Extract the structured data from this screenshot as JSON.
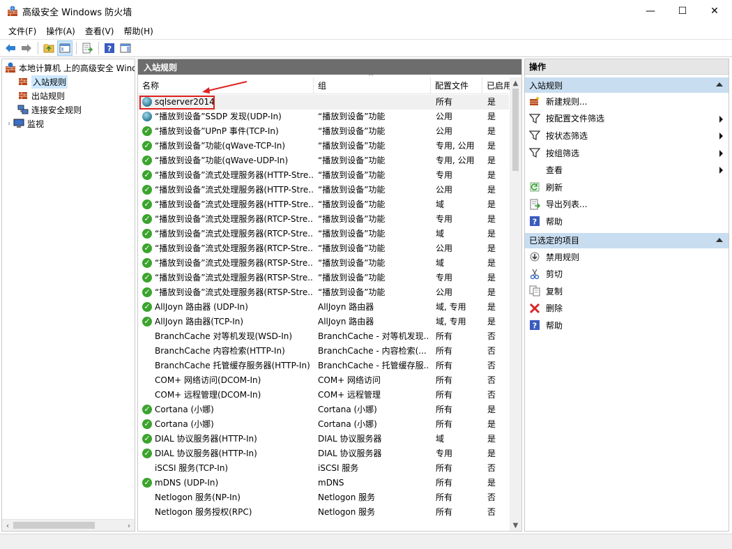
{
  "window": {
    "title": "高级安全 Windows 防火墙",
    "minimize": "—",
    "maximize": "☐",
    "close": "✕"
  },
  "menu": [
    "文件(F)",
    "操作(A)",
    "查看(V)",
    "帮助(H)"
  ],
  "toolbar": {
    "icons": [
      "back-arrow-icon",
      "forward-arrow-icon",
      "up-folder-icon",
      "show-hide-tree-icon",
      "export-list-icon",
      "help-icon",
      "show-hide-action-pane-icon"
    ]
  },
  "tree": {
    "root": "本地计算机 上的高级安全 Windows 防火墙",
    "items": [
      "入站规则",
      "出站规则",
      "连接安全规则",
      "监视"
    ]
  },
  "center": {
    "header": "入站规则",
    "columns": [
      "名称",
      "组",
      "配置文件",
      "已启用"
    ],
    "rows": [
      {
        "name": "sqlserver2014",
        "group": "",
        "profile": "所有",
        "enabled": "是",
        "icon": "globe"
      },
      {
        "name": "“播放到设备”SSDP 发现(UDP-In)",
        "group": "“播放到设备”功能",
        "profile": "公用",
        "enabled": "是",
        "icon": "globe"
      },
      {
        "name": "“播放到设备”UPnP 事件(TCP-In)",
        "group": "“播放到设备”功能",
        "profile": "公用",
        "enabled": "是",
        "icon": "check"
      },
      {
        "name": "“播放到设备”功能(qWave-TCP-In)",
        "group": "“播放到设备”功能",
        "profile": "专用, 公用",
        "enabled": "是",
        "icon": "check"
      },
      {
        "name": "“播放到设备”功能(qWave-UDP-In)",
        "group": "“播放到设备”功能",
        "profile": "专用, 公用",
        "enabled": "是",
        "icon": "check"
      },
      {
        "name": "“播放到设备”流式处理服务器(HTTP-Stre...",
        "group": "“播放到设备”功能",
        "profile": "专用",
        "enabled": "是",
        "icon": "check"
      },
      {
        "name": "“播放到设备”流式处理服务器(HTTP-Stre...",
        "group": "“播放到设备”功能",
        "profile": "公用",
        "enabled": "是",
        "icon": "check"
      },
      {
        "name": "“播放到设备”流式处理服务器(HTTP-Stre...",
        "group": "“播放到设备”功能",
        "profile": "域",
        "enabled": "是",
        "icon": "check"
      },
      {
        "name": "“播放到设备”流式处理服务器(RTCP-Stre...",
        "group": "“播放到设备”功能",
        "profile": "专用",
        "enabled": "是",
        "icon": "check"
      },
      {
        "name": "“播放到设备”流式处理服务器(RTCP-Stre...",
        "group": "“播放到设备”功能",
        "profile": "域",
        "enabled": "是",
        "icon": "check"
      },
      {
        "name": "“播放到设备”流式处理服务器(RTCP-Stre...",
        "group": "“播放到设备”功能",
        "profile": "公用",
        "enabled": "是",
        "icon": "check"
      },
      {
        "name": "“播放到设备”流式处理服务器(RTSP-Stre...",
        "group": "“播放到设备”功能",
        "profile": "域",
        "enabled": "是",
        "icon": "check"
      },
      {
        "name": "“播放到设备”流式处理服务器(RTSP-Stre...",
        "group": "“播放到设备”功能",
        "profile": "专用",
        "enabled": "是",
        "icon": "check"
      },
      {
        "name": "“播放到设备”流式处理服务器(RTSP-Stre...",
        "group": "“播放到设备”功能",
        "profile": "公用",
        "enabled": "是",
        "icon": "check"
      },
      {
        "name": "AllJoyn 路由器 (UDP-In)",
        "group": "AllJoyn 路由器",
        "profile": "域, 专用",
        "enabled": "是",
        "icon": "check"
      },
      {
        "name": "AllJoyn 路由器(TCP-In)",
        "group": "AllJoyn 路由器",
        "profile": "域, 专用",
        "enabled": "是",
        "icon": "check"
      },
      {
        "name": "BranchCache 对等机发现(WSD-In)",
        "group": "BranchCache - 对等机发现...",
        "profile": "所有",
        "enabled": "否",
        "icon": "none"
      },
      {
        "name": "BranchCache 内容检索(HTTP-In)",
        "group": "BranchCache - 内容检索(...",
        "profile": "所有",
        "enabled": "否",
        "icon": "none"
      },
      {
        "name": "BranchCache 托管缓存服务器(HTTP-In)",
        "group": "BranchCache - 托管缓存服...",
        "profile": "所有",
        "enabled": "否",
        "icon": "none"
      },
      {
        "name": "COM+ 网络访问(DCOM-In)",
        "group": "COM+ 网络访问",
        "profile": "所有",
        "enabled": "否",
        "icon": "none"
      },
      {
        "name": "COM+ 远程管理(DCOM-In)",
        "group": "COM+ 远程管理",
        "profile": "所有",
        "enabled": "否",
        "icon": "none"
      },
      {
        "name": "Cortana (小娜)",
        "group": "Cortana (小娜)",
        "profile": "所有",
        "enabled": "是",
        "icon": "check"
      },
      {
        "name": "Cortana (小娜)",
        "group": "Cortana (小娜)",
        "profile": "所有",
        "enabled": "是",
        "icon": "check"
      },
      {
        "name": "DIAL 协议服务器(HTTP-In)",
        "group": "DIAL 协议服务器",
        "profile": "域",
        "enabled": "是",
        "icon": "check"
      },
      {
        "name": "DIAL 协议服务器(HTTP-In)",
        "group": "DIAL 协议服务器",
        "profile": "专用",
        "enabled": "是",
        "icon": "check"
      },
      {
        "name": "iSCSI 服务(TCP-In)",
        "group": "iSCSI 服务",
        "profile": "所有",
        "enabled": "否",
        "icon": "none"
      },
      {
        "name": "mDNS (UDP-In)",
        "group": "mDNS",
        "profile": "所有",
        "enabled": "是",
        "icon": "check"
      },
      {
        "name": "Netlogon 服务(NP-In)",
        "group": "Netlogon 服务",
        "profile": "所有",
        "enabled": "否",
        "icon": "none"
      },
      {
        "name": "Netlogon 服务授权(RPC)",
        "group": "Netlogon 服务",
        "profile": "所有",
        "enabled": "否",
        "icon": "none"
      }
    ]
  },
  "actions": {
    "header": "操作",
    "section1": "入站规则",
    "items1": [
      {
        "label": "新建规则...",
        "icon": "new-rule-icon",
        "sub": false
      },
      {
        "label": "按配置文件筛选",
        "icon": "filter-icon",
        "sub": true
      },
      {
        "label": "按状态筛选",
        "icon": "filter-icon",
        "sub": true
      },
      {
        "label": "按组筛选",
        "icon": "filter-icon",
        "sub": true
      },
      {
        "label": "查看",
        "icon": "none",
        "sub": true
      },
      {
        "label": "刷新",
        "icon": "refresh-icon",
        "sub": false
      },
      {
        "label": "导出列表...",
        "icon": "export-list-icon",
        "sub": false
      },
      {
        "label": "帮助",
        "icon": "help-icon",
        "sub": false
      }
    ],
    "section2": "已选定的项目",
    "items2": [
      {
        "label": "禁用规则",
        "icon": "disable-rule-icon"
      },
      {
        "label": "剪切",
        "icon": "cut-icon"
      },
      {
        "label": "复制",
        "icon": "copy-icon"
      },
      {
        "label": "删除",
        "icon": "delete-icon"
      },
      {
        "label": "帮助",
        "icon": "help-icon"
      }
    ]
  },
  "colors": {
    "pane_header_bg": "#6d6d6d",
    "section_bg": "#c8ddf0",
    "selection_bg": "#cde8ff",
    "enabled_check": "#3ba42d",
    "highlight_border": "#e02020"
  }
}
